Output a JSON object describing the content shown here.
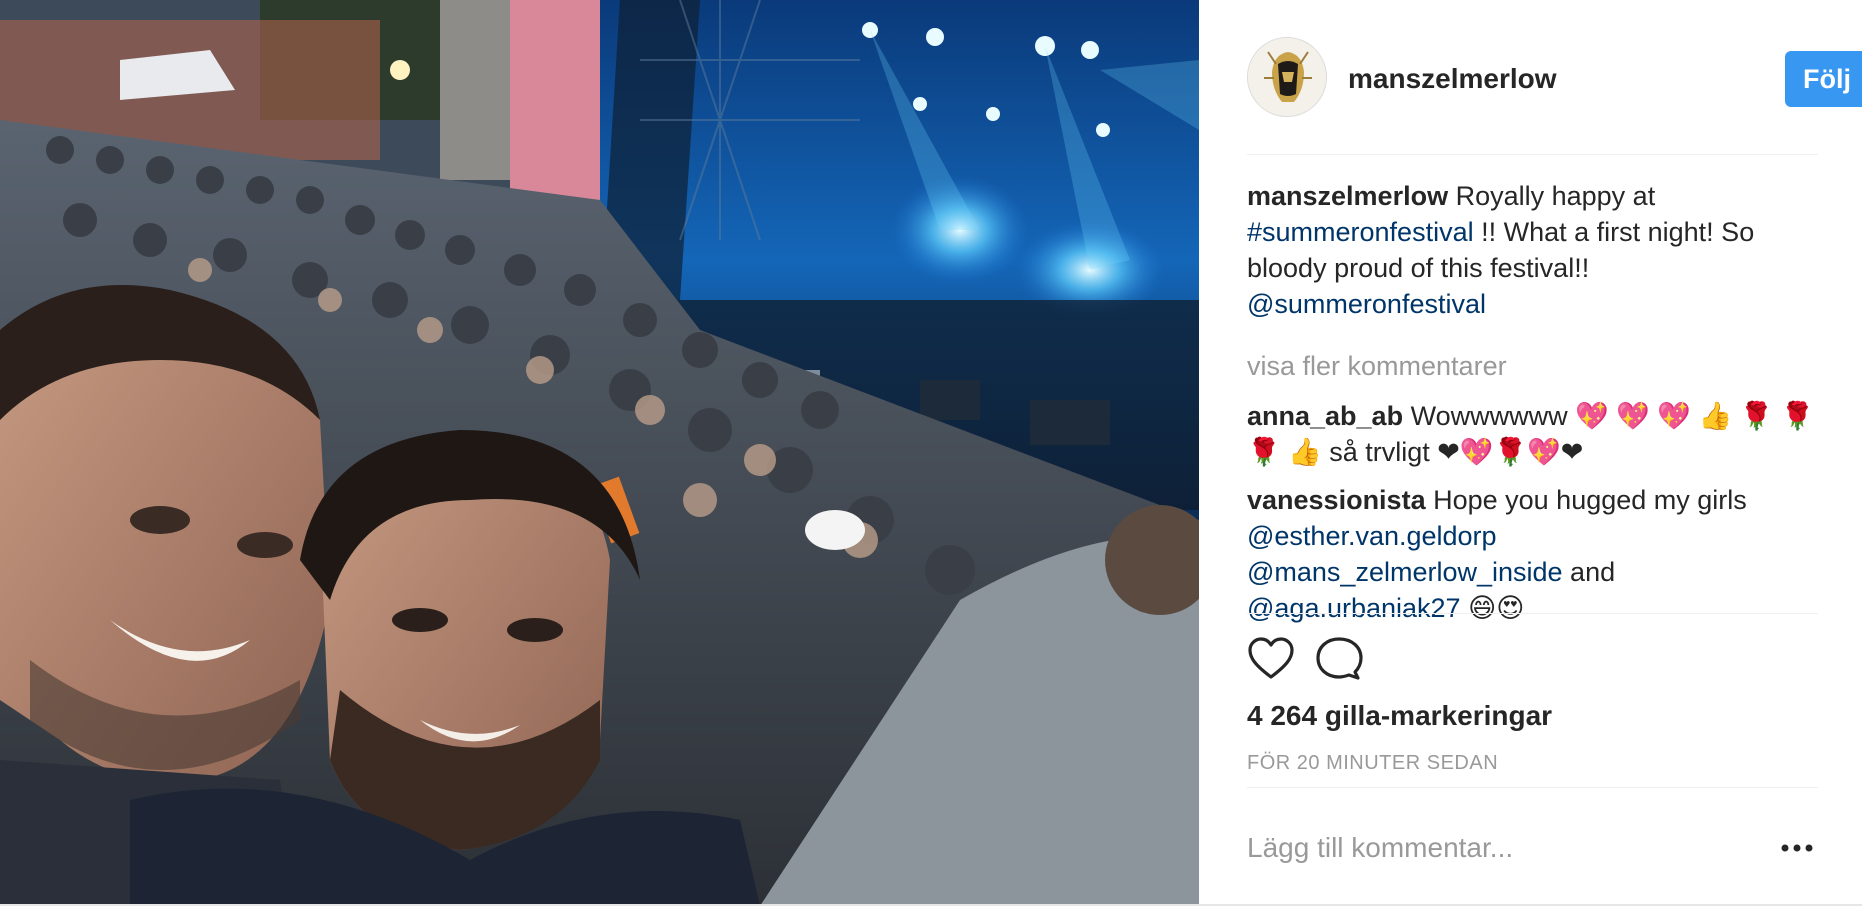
{
  "post": {
    "photo_alt": "",
    "author": {
      "username": "manszelmerlow",
      "follow_label": "Följ"
    },
    "caption": {
      "username": "manszelmerlow",
      "text_1": " Royally happy at ",
      "hashtag": "#summeronfestival",
      "text_2": " !! What a first night! So bloody proud of this festival!! ",
      "mention": "@summeronfestival"
    },
    "more_comments_label": "visa fler kommentarer",
    "comments": [
      {
        "username": "anna_ab_ab",
        "text": " Wowwwwww 💖 💖 💖 👍 🌹 🌹 🌹 👍 så trvligt ❤💖🌹💖❤"
      },
      {
        "username": "vanessionista",
        "text_1": " Hope you hugged my girls ",
        "mention_1": "@esther.van.geldorp",
        "mention_2": "@mans_zelmerlow_inside",
        "text_2": " and ",
        "mention_3": "@aga.urbaniak27",
        "text_3": " 😄😍"
      }
    ],
    "icons": {
      "like": "heart-icon",
      "comment": "comment-icon",
      "more": "more-options-icon"
    },
    "likes_label": "4 264 gilla-markeringar",
    "timestamp": "FÖR 20 MINUTER SEDAN",
    "add_comment_placeholder": "Lägg till kommentar...",
    "colors": {
      "follow_button": "#3897f0",
      "link": "#003569",
      "muted": "#999999",
      "text": "#262626"
    }
  }
}
